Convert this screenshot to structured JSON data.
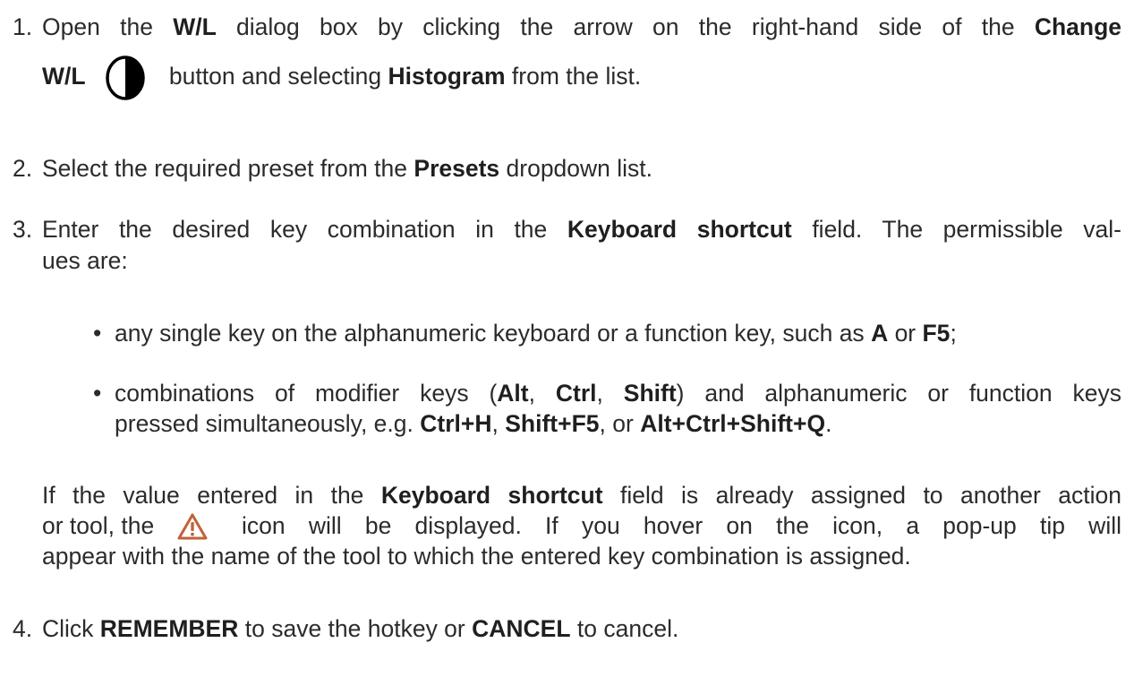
{
  "steps": [
    {
      "number": "1.",
      "line1": {
        "t1": "Open the ",
        "b1": "W/L",
        "t2": " dialog box by clicking the arrow on the right-hand side of the ",
        "b2": "Change"
      },
      "line2": {
        "b1": "W/L",
        "icon": "half-contrast-icon",
        "t1": " button and selecting ",
        "b2": "Histogram",
        "t2": " from the list."
      }
    },
    {
      "number": "2.",
      "t1": "Select the required preset from the ",
      "b1": "Presets",
      "t2": " dropdown list."
    },
    {
      "number": "3.",
      "line1": {
        "t1": "Enter the desired key combination in the ",
        "b1": "Keyboard shortcut",
        "t2": " field.  The permissible val-"
      },
      "line2": "ues are:",
      "bullets": [
        {
          "t1": "any single key on the alphanumeric keyboard or a function key, such as ",
          "b1": "A",
          "t2": " or ",
          "b2": "F5",
          "t3": ";"
        },
        {
          "line1": {
            "t1": "combinations of modifier keys (",
            "b1": "Alt",
            "t2": ", ",
            "b2": "Ctrl",
            "t3": ", ",
            "b3": "Shift",
            "t4": ") and alphanumeric or function keys"
          },
          "line2": {
            "t1": "pressed simultaneously, e.g. ",
            "b1": "Ctrl+H",
            "t2": ", ",
            "b2": "Shift+F5",
            "t3": ", or ",
            "b3": "Alt+Ctrl+Shift+Q",
            "t4": "."
          }
        }
      ],
      "note": {
        "line1": {
          "t1": "If the value entered in the ",
          "b1": "Keyboard shortcut",
          "t2": " field is already assigned to another action"
        },
        "line2": {
          "t1": "or tool, the",
          "icon": "warning-icon",
          "t2": "icon will be displayed.  If you hover on the icon, a pop-up tip will"
        },
        "line3": "appear with the name of the tool to which the entered key combination is assigned."
      }
    },
    {
      "number": "4.",
      "t1": "Click ",
      "b1": "REMEMBER",
      "t2": " to save the hotkey or ",
      "b2": "CANCEL",
      "t3": " to cancel."
    }
  ],
  "colors": {
    "text": "#2b2b2b",
    "warning": "#c0623a",
    "icon": "#000000"
  }
}
